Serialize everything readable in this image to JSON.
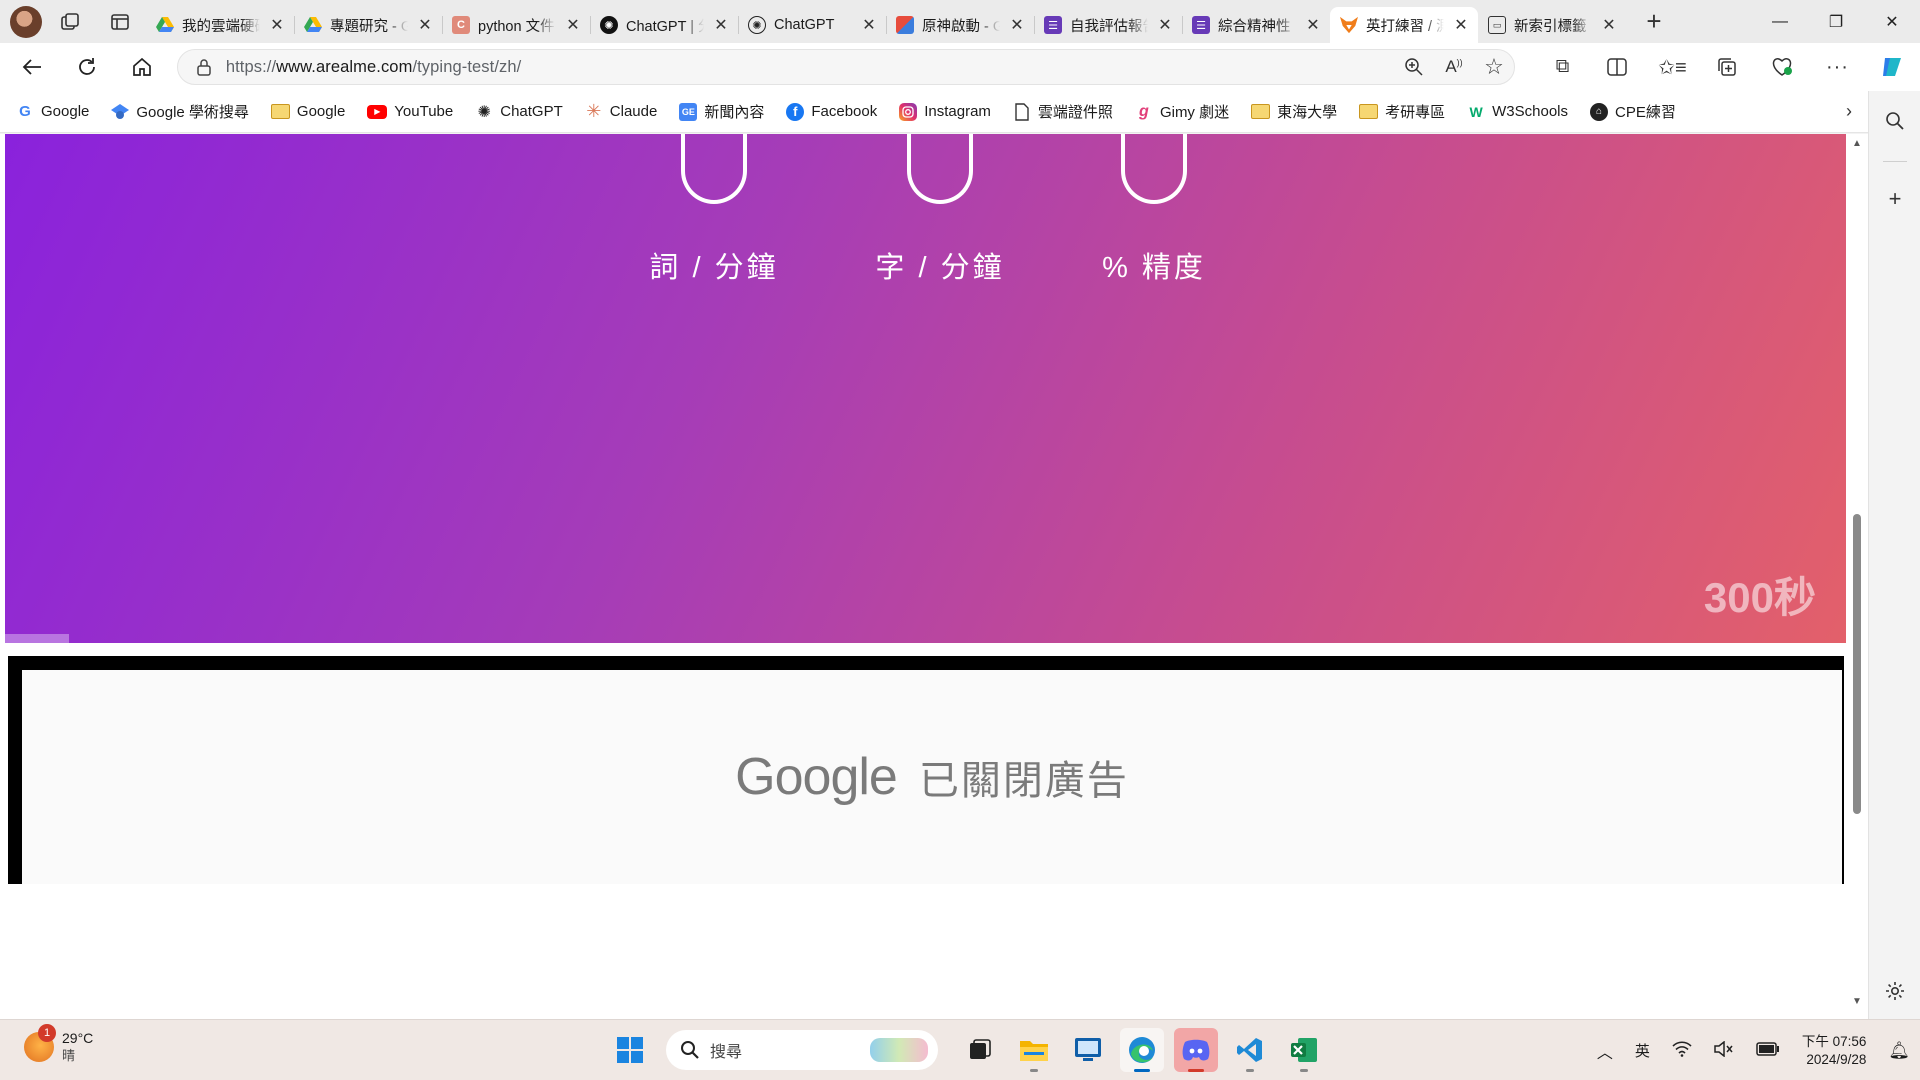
{
  "browser": {
    "tabs": [
      {
        "title": "我的雲端硬碟 - Google",
        "favicon": "google-drive-icon",
        "color": "#34a853",
        "active": false
      },
      {
        "title": "專題研究 - Google",
        "favicon": "google-drive-icon",
        "color": "#34a853",
        "active": false
      },
      {
        "title": "python 文件",
        "favicon": "c-letter-icon",
        "color": "#e08a7a",
        "active": false
      },
      {
        "title": "ChatGPT | 分享",
        "favicon": "chatgpt-icon",
        "color": "#111111",
        "active": false
      },
      {
        "title": "ChatGPT",
        "favicon": "chatgpt-icon",
        "color": "#ffffff",
        "active": false
      },
      {
        "title": "原神啟動 - Gimy",
        "favicon": "gimy-icon",
        "color": "#3b7ddd",
        "active": false
      },
      {
        "title": "自我評估報告",
        "favicon": "form-icon",
        "color": "#673ab7",
        "active": false
      },
      {
        "title": "綜合精神性",
        "favicon": "form-icon",
        "color": "#673ab7",
        "active": false
      },
      {
        "title": "英打練習 / 測試",
        "favicon": "fox-icon",
        "color": "#f07d1a",
        "active": true
      },
      {
        "title": "新索引標籤",
        "favicon": "newtab-icon",
        "color": "#333333",
        "active": false
      }
    ],
    "url_prefix": "https://",
    "url_host": "www.arealme.com",
    "url_path": "/typing-test/zh/"
  },
  "favorites": [
    {
      "label": "Google",
      "icon": "google-icon"
    },
    {
      "label": "Google 學術搜尋",
      "icon": "scholar-icon"
    },
    {
      "label": "Google",
      "icon": "folder-icon"
    },
    {
      "label": "YouTube",
      "icon": "youtube-icon"
    },
    {
      "label": "ChatGPT",
      "icon": "chatgpt-icon"
    },
    {
      "label": "Claude",
      "icon": "claude-icon"
    },
    {
      "label": "新聞內容",
      "icon": "news-icon"
    },
    {
      "label": "Facebook",
      "icon": "facebook-icon"
    },
    {
      "label": "Instagram",
      "icon": "instagram-icon"
    },
    {
      "label": "雲端證件照",
      "icon": "page-icon"
    },
    {
      "label": "Gimy 劇迷",
      "icon": "gimy-icon"
    },
    {
      "label": "東海大學",
      "icon": "folder-icon"
    },
    {
      "label": "考研專區",
      "icon": "folder-icon"
    },
    {
      "label": "W3Schools",
      "icon": "w3schools-icon"
    },
    {
      "label": "CPE練習",
      "icon": "github-icon"
    }
  ],
  "page": {
    "stats": [
      {
        "label": "詞 / 分鐘"
      },
      {
        "label": "字 / 分鐘"
      },
      {
        "label": "% 精度"
      }
    ],
    "timer": "300秒",
    "progress_percent": 3.5,
    "hero_colors": [
      "#8a22dc",
      "#e3606a"
    ],
    "ad_brand": "Google",
    "ad_message": "已關閉廣告"
  },
  "taskbar": {
    "weather": {
      "temp": "29°C",
      "condition": "晴",
      "badge": "1"
    },
    "search_placeholder": "搜尋",
    "ime": "英",
    "time": "下午 07:56",
    "date": "2024/9/28"
  }
}
